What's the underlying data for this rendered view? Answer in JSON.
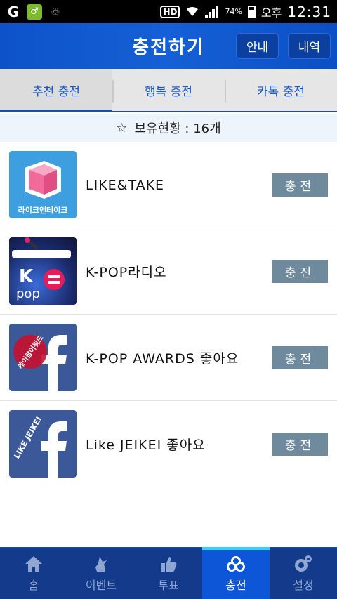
{
  "status_bar": {
    "hd": "HD",
    "battery_pct": "74%",
    "ampm": "오후",
    "time": "12:31"
  },
  "header": {
    "title": "충전하기",
    "guide_label": "안내",
    "history_label": "내역"
  },
  "tabs": [
    {
      "label": "추천 충전"
    },
    {
      "label": "행복 충전"
    },
    {
      "label": "카톡 충전"
    }
  ],
  "holdings": {
    "star": "☆",
    "text": "보유현황 : 16개"
  },
  "items": [
    {
      "name": "LIKE&TAKE",
      "icon_caption": "라이크앤테이크",
      "button": "충전"
    },
    {
      "name": "K-POP라디오",
      "icon_caption": "",
      "button": "충전"
    },
    {
      "name": "K-POP AWARDS 좋아요",
      "icon_caption": "케이팝어워드",
      "button": "충전"
    },
    {
      "name": "Like JEIKEI 좋아요",
      "icon_caption": "LIKE JEIKEI",
      "button": "충전"
    }
  ],
  "bottom_nav": [
    {
      "label": "홈",
      "icon": "home-icon"
    },
    {
      "label": "이벤트",
      "icon": "event-icon"
    },
    {
      "label": "투표",
      "icon": "thumbs-up-icon"
    },
    {
      "label": "충전",
      "icon": "charge-icon"
    },
    {
      "label": "설정",
      "icon": "gear-icon"
    }
  ],
  "colors": {
    "header_blue": "#0d52c8",
    "tab_text": "#1a57c9",
    "charge_button": "#6e8a9c",
    "nav_bg": "#143a8c",
    "nav_active": "#0d56d8"
  }
}
